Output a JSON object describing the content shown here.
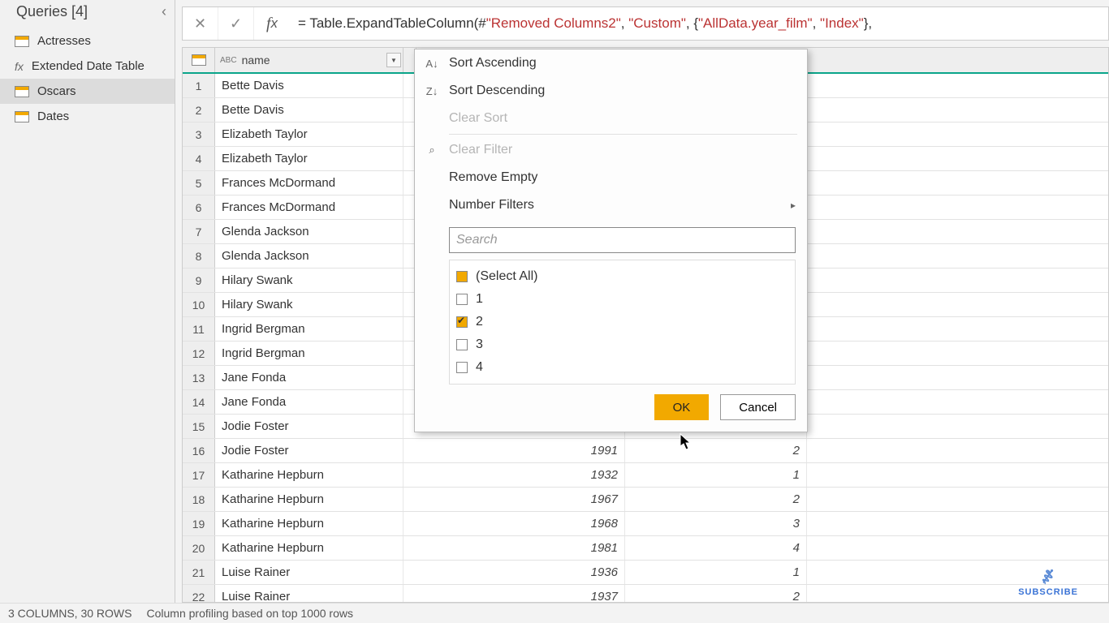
{
  "left_panel": {
    "title": "Queries [4]",
    "items": [
      {
        "icon": "table",
        "label": "Actresses",
        "selected": false
      },
      {
        "icon": "fx",
        "label": "Extended Date Table",
        "selected": false
      },
      {
        "icon": "table",
        "label": "Oscars",
        "selected": true
      },
      {
        "icon": "table",
        "label": "Dates",
        "selected": false
      }
    ]
  },
  "formula": {
    "prefix": "= Table.ExpandTableColumn(#",
    "s1": "\"Removed Columns2\"",
    "c1": ", ",
    "s2": "\"Custom\"",
    "c2": ", {",
    "s3": "\"AllData.year_film\"",
    "c3": ", ",
    "s4": "\"Index\"",
    "suffix": "},"
  },
  "columns": {
    "name_label": "name",
    "name_type": "ABC"
  },
  "rows": [
    {
      "n": 1,
      "name": "Bette Davis"
    },
    {
      "n": 2,
      "name": "Bette Davis"
    },
    {
      "n": 3,
      "name": "Elizabeth Taylor"
    },
    {
      "n": 4,
      "name": "Elizabeth Taylor"
    },
    {
      "n": 5,
      "name": "Frances McDormand"
    },
    {
      "n": 6,
      "name": "Frances McDormand"
    },
    {
      "n": 7,
      "name": "Glenda Jackson"
    },
    {
      "n": 8,
      "name": "Glenda Jackson"
    },
    {
      "n": 9,
      "name": "Hilary Swank"
    },
    {
      "n": 10,
      "name": "Hilary Swank"
    },
    {
      "n": 11,
      "name": "Ingrid Bergman"
    },
    {
      "n": 12,
      "name": "Ingrid Bergman"
    },
    {
      "n": 13,
      "name": "Jane Fonda"
    },
    {
      "n": 14,
      "name": "Jane Fonda"
    },
    {
      "n": 15,
      "name": "Jodie Foster"
    },
    {
      "n": 16,
      "name": "Jodie Foster",
      "year": "1991",
      "idx": "2"
    },
    {
      "n": 17,
      "name": "Katharine Hepburn",
      "year": "1932",
      "idx": "1"
    },
    {
      "n": 18,
      "name": "Katharine Hepburn",
      "year": "1967",
      "idx": "2"
    },
    {
      "n": 19,
      "name": "Katharine Hepburn",
      "year": "1968",
      "idx": "3"
    },
    {
      "n": 20,
      "name": "Katharine Hepburn",
      "year": "1981",
      "idx": "4"
    },
    {
      "n": 21,
      "name": "Luise Rainer",
      "year": "1936",
      "idx": "1"
    },
    {
      "n": 22,
      "name": "Luise Rainer",
      "year": "1937",
      "idx": "2"
    }
  ],
  "filter_menu": {
    "sort_asc": "Sort Ascending",
    "sort_desc": "Sort Descending",
    "clear_sort": "Clear Sort",
    "clear_filter": "Clear Filter",
    "remove_empty": "Remove Empty",
    "number_filters": "Number Filters",
    "search_placeholder": "Search",
    "values": [
      {
        "label": "(Select All)",
        "state": "partial"
      },
      {
        "label": "1",
        "state": "off"
      },
      {
        "label": "2",
        "state": "checked"
      },
      {
        "label": "3",
        "state": "off"
      },
      {
        "label": "4",
        "state": "off"
      }
    ],
    "ok": "OK",
    "cancel": "Cancel"
  },
  "status": {
    "cols_rows": "3 COLUMNS, 30 ROWS",
    "profiling": "Column profiling based on top 1000 rows"
  },
  "subscribe": "SUBSCRIBE"
}
